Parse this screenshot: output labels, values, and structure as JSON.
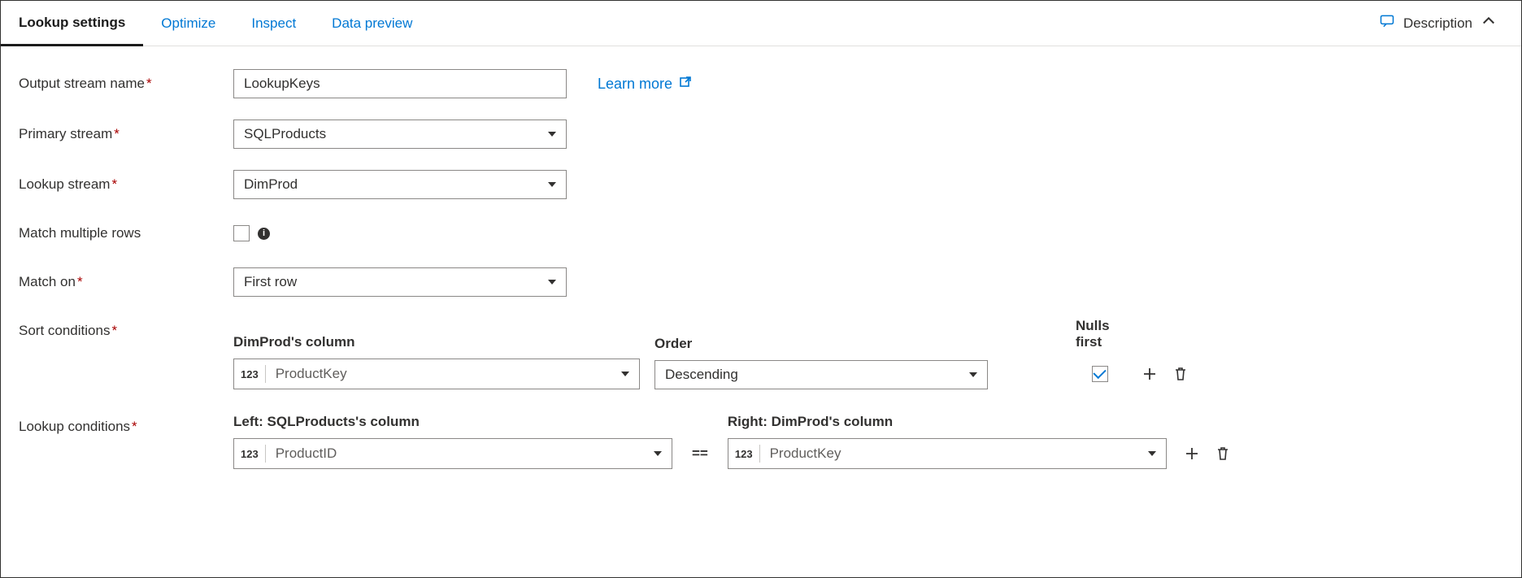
{
  "tabs": {
    "lookup_settings": "Lookup settings",
    "optimize": "Optimize",
    "inspect": "Inspect",
    "data_preview": "Data preview"
  },
  "header": {
    "description": "Description"
  },
  "labels": {
    "output_stream_name": "Output stream name",
    "primary_stream": "Primary stream",
    "lookup_stream": "Lookup stream",
    "match_multiple_rows": "Match multiple rows",
    "match_on": "Match on",
    "sort_conditions": "Sort conditions",
    "lookup_conditions": "Lookup conditions"
  },
  "values": {
    "output_stream_name": "LookupKeys",
    "primary_stream": "SQLProducts",
    "lookup_stream": "DimProd",
    "match_multiple_rows": false,
    "match_on": "First row"
  },
  "learn_more": "Learn more",
  "sort": {
    "column_header": "DimProd's column",
    "order_header": "Order",
    "nulls_header": "Nulls first",
    "column_type": "123",
    "column_value": "ProductKey",
    "order_value": "Descending",
    "nulls_first": true
  },
  "lookup": {
    "left_header": "Left: SQLProducts's column",
    "right_header": "Right: DimProd's column",
    "left_type": "123",
    "left_value": "ProductID",
    "operator": "==",
    "right_type": "123",
    "right_value": "ProductKey"
  }
}
